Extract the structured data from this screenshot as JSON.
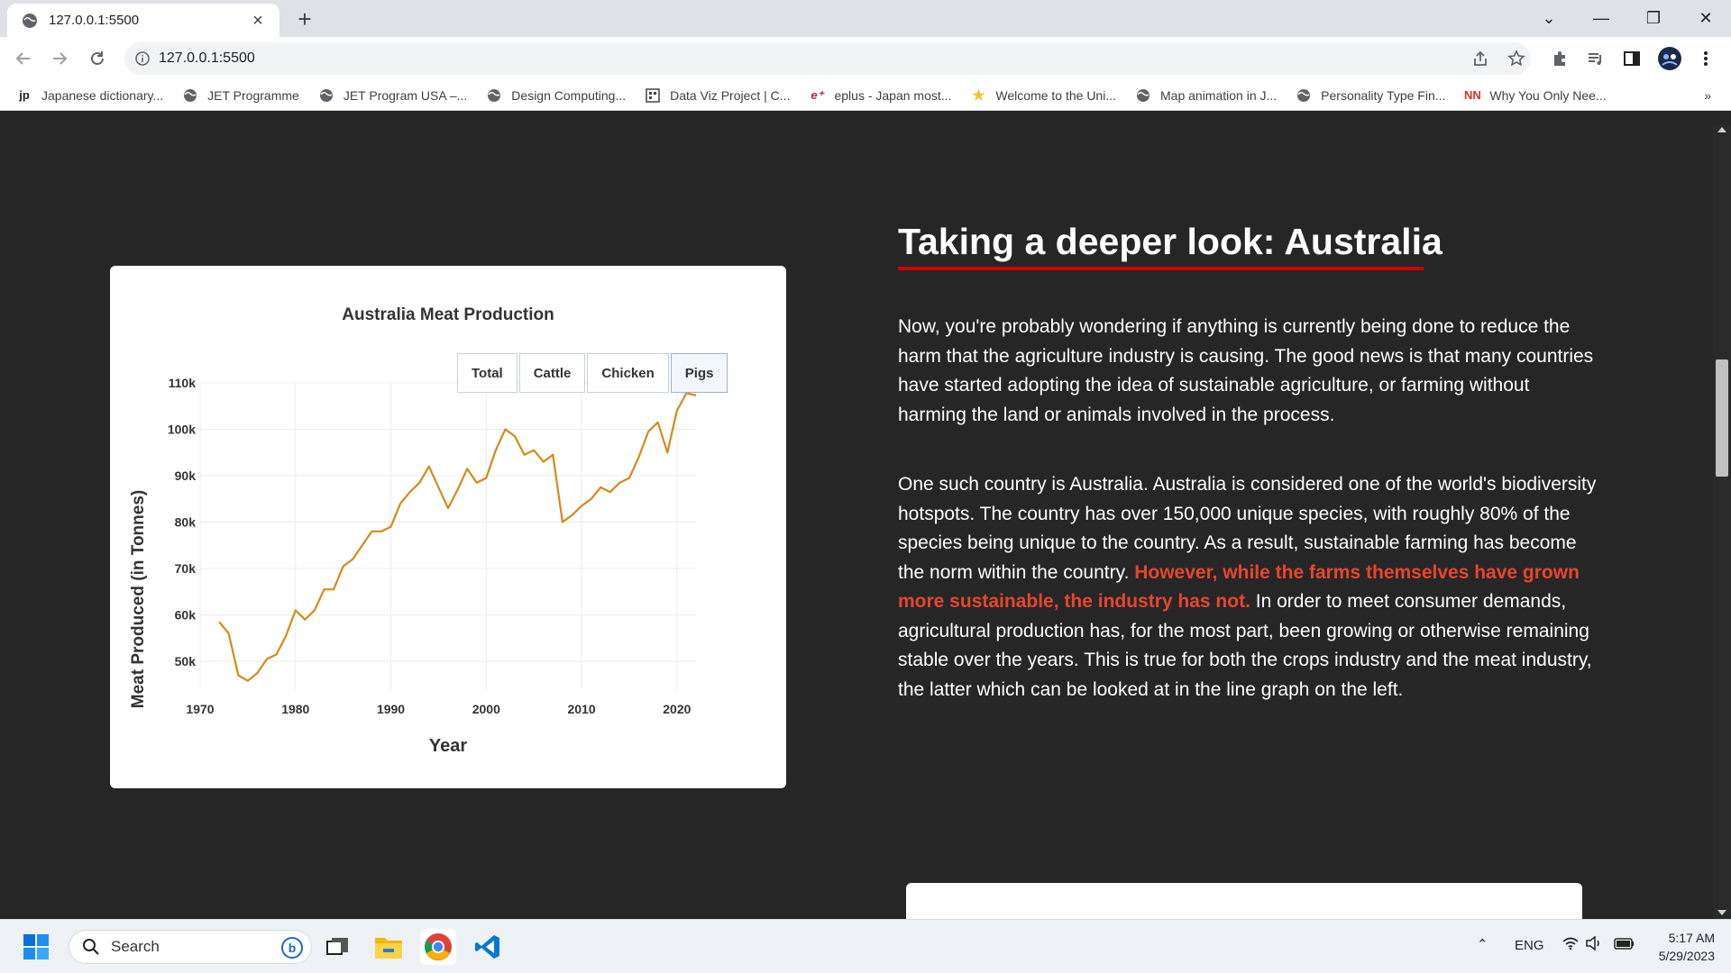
{
  "browser": {
    "tab_title": "127.0.0.1:5500",
    "url": "127.0.0.1:5500",
    "bookmarks": [
      {
        "label": "Japanese dictionary...",
        "icon": "jp"
      },
      {
        "label": "JET Programme",
        "icon": "globe"
      },
      {
        "label": "JET Program USA –...",
        "icon": "globe"
      },
      {
        "label": "Design Computing...",
        "icon": "globe"
      },
      {
        "label": "Data Viz Project | C...",
        "icon": "dataviz"
      },
      {
        "label": "eplus - Japan most...",
        "icon": "eplus"
      },
      {
        "label": "Welcome to the Uni...",
        "icon": "star"
      },
      {
        "label": "Map animation in J...",
        "icon": "globe"
      },
      {
        "label": "Personality Type Fin...",
        "icon": "globe"
      },
      {
        "label": "Why You Only Nee...",
        "icon": "nn"
      }
    ]
  },
  "article": {
    "heading": "Taking a deeper look: Australia",
    "para1": "Now, you're probably wondering if anything is currently being done to reduce the harm that the agriculture industry is causing. The good news is that many countries have started adopting the idea of sustainable agriculture, or farming without harming the land or animals involved in the process.",
    "para2_before": "One such country is Australia. Australia is considered one of the world's biodiversity hotspots. The country has over 150,000 unique species, with roughly 80% of the species being unique to the country. As a result, sustainable farming has become the norm within the country. ",
    "para2_highlight": "However, while the farms themselves have grown more sustainable, the industry has not.",
    "para2_after": " In order to meet consumer demands, agricultural production has, for the most part, been growing or otherwise remaining stable over the years. This is true for both the crops industry and the meat industry, the latter which can be looked at in the line graph on the left.",
    "highlight_color": "#e8452c"
  },
  "chart_buttons": [
    "Total",
    "Cattle",
    "Chicken",
    "Pigs"
  ],
  "chart_data": {
    "type": "line",
    "title": "Australia Meat Production",
    "xlabel": "Year",
    "ylabel": "Meat Produced (in Tonnes)",
    "xlim": [
      1970,
      2022
    ],
    "ylim": [
      44000,
      110000
    ],
    "x_ticks": [
      1970,
      1980,
      1990,
      2000,
      2010,
      2020
    ],
    "y_ticks": [
      50000,
      60000,
      70000,
      80000,
      90000,
      100000,
      110000
    ],
    "y_tick_labels": [
      "50k",
      "60k",
      "70k",
      "80k",
      "90k",
      "100k",
      "110k"
    ],
    "grid": true,
    "line_color": "#d38a1c",
    "series": [
      {
        "selected_button": "Pigs",
        "x": [
          1972,
          1973,
          1974,
          1975,
          1976,
          1977,
          1978,
          1979,
          1980,
          1981,
          1982,
          1983,
          1984,
          1985,
          1986,
          1987,
          1988,
          1989,
          1990,
          1991,
          1992,
          1993,
          1994,
          1995,
          1996,
          1997,
          1998,
          1999,
          2000,
          2001,
          2002,
          2003,
          2004,
          2005,
          2006,
          2007,
          2008,
          2009,
          2010,
          2011,
          2012,
          2013,
          2014,
          2015,
          2016,
          2017,
          2018,
          2019,
          2020,
          2021,
          2022
        ],
        "values": [
          58500,
          56000,
          47000,
          45800,
          47500,
          50500,
          51500,
          55500,
          61000,
          59000,
          61000,
          65500,
          65500,
          70500,
          72000,
          75000,
          78000,
          78000,
          79000,
          84000,
          86500,
          88500,
          92000,
          87500,
          83000,
          87000,
          91500,
          88500,
          89500,
          95500,
          100000,
          98500,
          94500,
          95500,
          93000,
          94500,
          80000,
          81500,
          83500,
          85000,
          87500,
          86500,
          88500,
          89500,
          94000,
          99500,
          101500,
          95000,
          104000,
          107800,
          107300
        ]
      }
    ]
  },
  "taskbar": {
    "search_placeholder": "Search",
    "lang": "ENG",
    "time": "5:17 AM",
    "date": "5/29/2023"
  }
}
